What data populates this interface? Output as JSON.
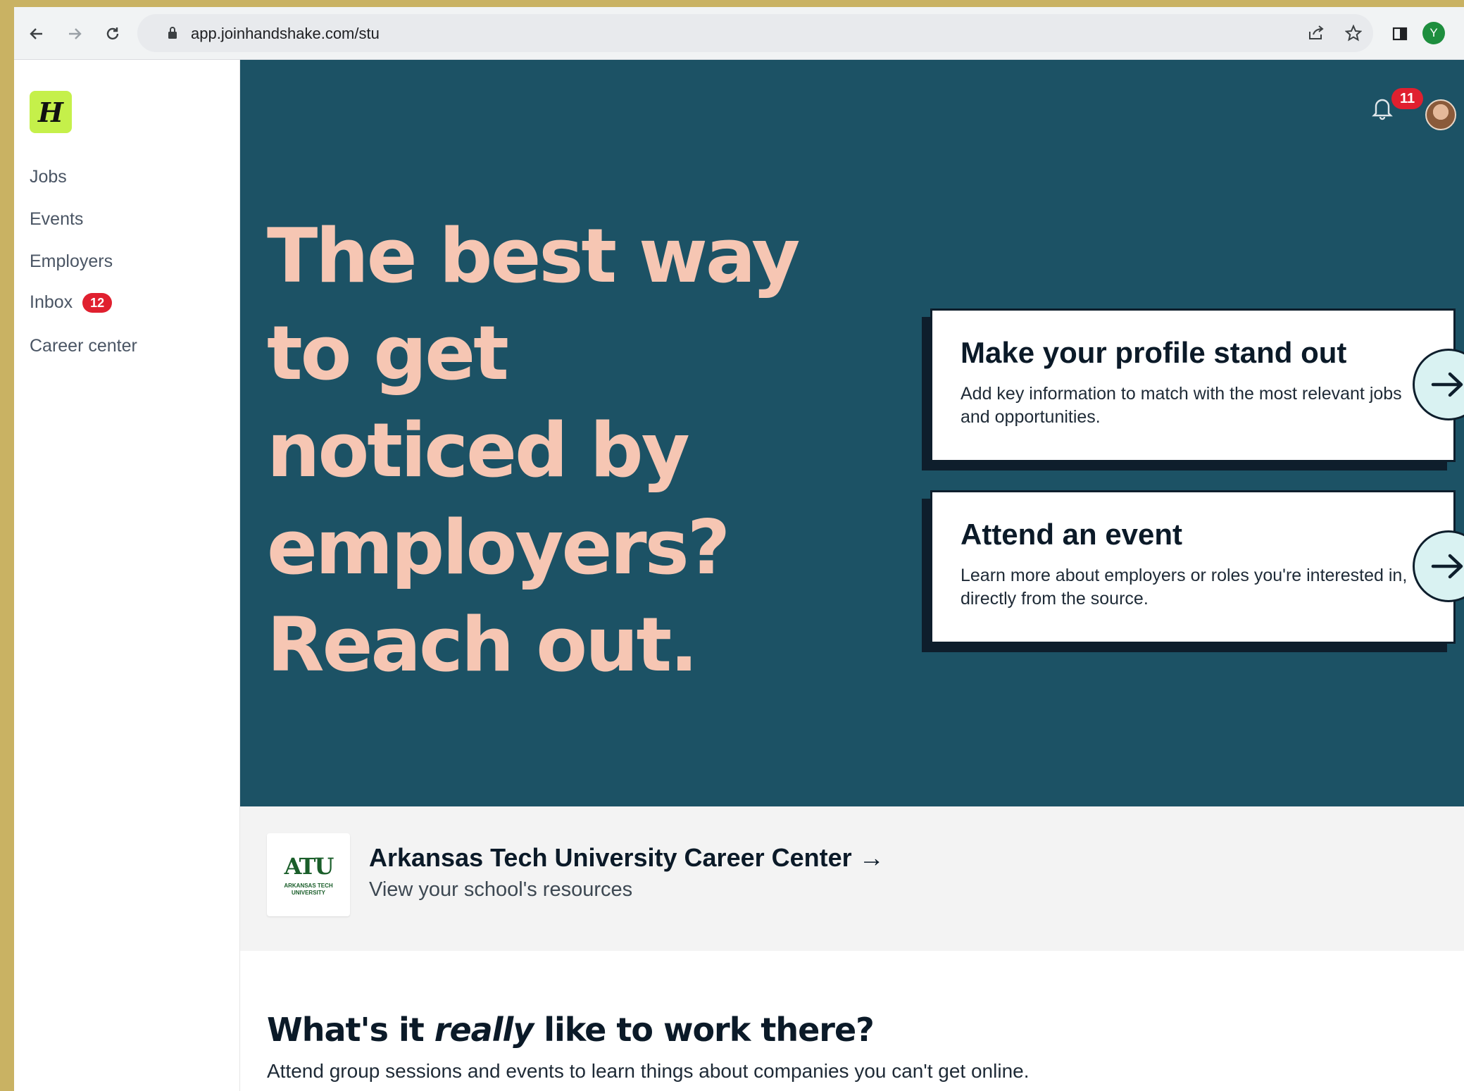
{
  "browser": {
    "url": "app.joinhandshake.com/stu",
    "profile_initial": "Y"
  },
  "sidebar": {
    "logo_letter": "H",
    "items": [
      {
        "label": "Jobs"
      },
      {
        "label": "Events"
      },
      {
        "label": "Employers"
      },
      {
        "label": "Inbox",
        "badge": "12"
      },
      {
        "label": "Career center"
      }
    ]
  },
  "header": {
    "notification_count": "11"
  },
  "hero": {
    "title_lines": [
      "The best way",
      "to get",
      "noticed by",
      "employers?",
      "Reach out."
    ],
    "cards": [
      {
        "title": "Make your profile stand out",
        "body": "Add key information to match with the most relevant jobs and opportunities."
      },
      {
        "title": "Attend an event",
        "body": "Learn more about employers or roles you're interested in, directly from the source."
      }
    ]
  },
  "school": {
    "logo_abbr": "ATU",
    "logo_sub": "ARKANSAS TECH UNIVERSITY",
    "title": "Arkansas Tech University Career Center →",
    "subtitle": "View your school's resources"
  },
  "section": {
    "title_before": "What's it ",
    "title_emph": "really",
    "title_after": " like to work there?",
    "subtitle": "Attend group sessions and events to learn things about companies you can't get online."
  },
  "colors": {
    "hero_bg": "#1c5265",
    "hero_text": "#f6c6b3",
    "logo_bg": "#c5f04a",
    "badge": "#e0202f",
    "arrow_bg": "#d9f2f2"
  }
}
